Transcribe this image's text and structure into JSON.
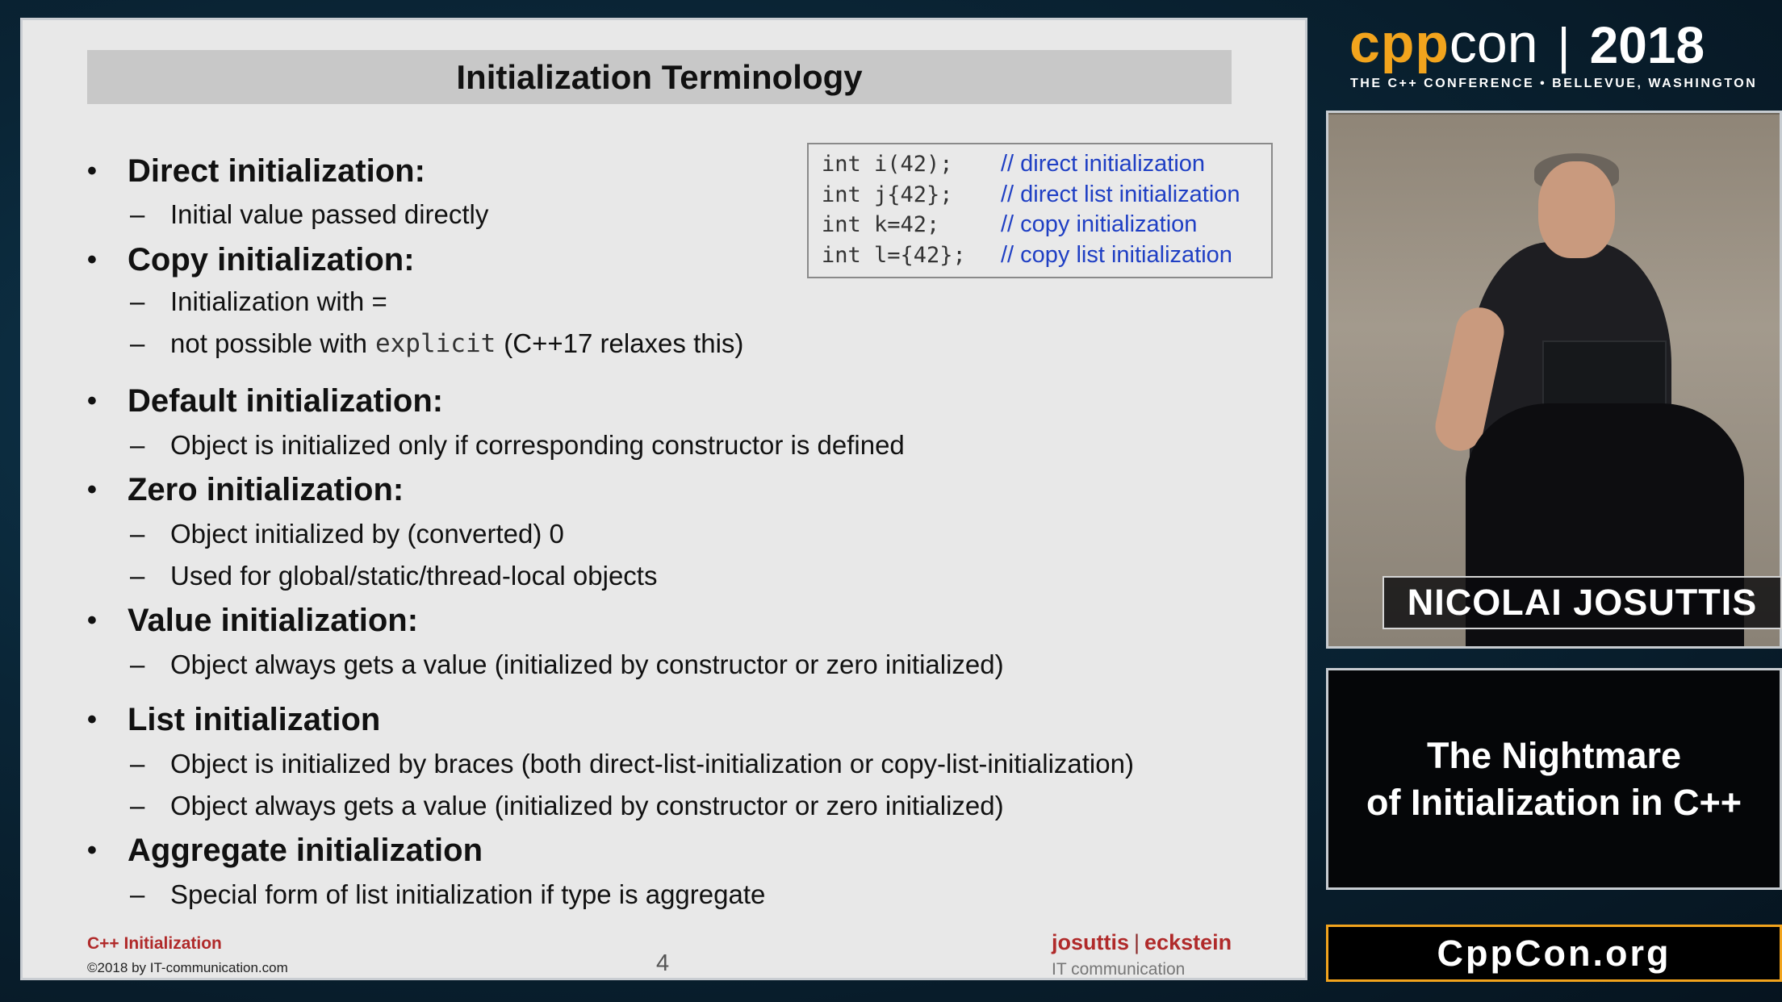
{
  "slide": {
    "title": "Initialization Terminology",
    "bullet_symbol": "•",
    "sub_symbol": "–",
    "items": [
      {
        "heading": "Direct initialization:",
        "subs": [
          "Initial value passed directly"
        ]
      },
      {
        "heading": "Copy initialization:",
        "subs": [
          "Initialization with =",
          "not possible with",
          "explicit",
          "(C++17 relaxes this)"
        ]
      },
      {
        "heading": "Default initialization:",
        "subs": [
          "Object is initialized only if corresponding constructor is defined"
        ]
      },
      {
        "heading": "Zero initialization:",
        "subs": [
          "Object initialized by (converted) 0",
          "Used for global/static/thread-local objects"
        ]
      },
      {
        "heading": "Value initialization:",
        "subs": [
          "Object always gets a value (initialized by constructor or zero initialized)"
        ]
      },
      {
        "heading": "List initialization",
        "subs": [
          "Object is initialized by braces (both direct-list-initialization or copy-list-initialization)",
          "Object always gets a value (initialized by constructor or zero initialized)"
        ]
      },
      {
        "heading": "Aggregate initialization",
        "subs": [
          "Special form of list initialization if type is aggregate"
        ]
      }
    ],
    "code": [
      {
        "code": "int i(42);",
        "comment": "// direct initialization"
      },
      {
        "code": "int j{42};",
        "comment": "// direct list initialization"
      },
      {
        "code": "int k=42;",
        "comment": "// copy initialization"
      },
      {
        "code": "int l={42};",
        "comment": "// copy list initialization"
      }
    ],
    "footer": {
      "topic": "C++ Initialization",
      "copyright": "©2018 by IT-communication.com",
      "page": "4",
      "brand_a": "josuttis",
      "brand_sep": "|",
      "brand_b": "eckstein",
      "brand_sub": "IT communication"
    }
  },
  "conference": {
    "logo_cpp": "cpp",
    "logo_con": "con",
    "logo_sep": "|",
    "year": "2018",
    "subtitle": "THE C++ CONFERENCE • BELLEVUE, WASHINGTON",
    "speaker": "NICOLAI JOSUTTIS",
    "talk_line1": "The Nightmare",
    "talk_line2": "of Initialization in C++",
    "site": "CppCon.org",
    "accent": "#f2a41d"
  }
}
